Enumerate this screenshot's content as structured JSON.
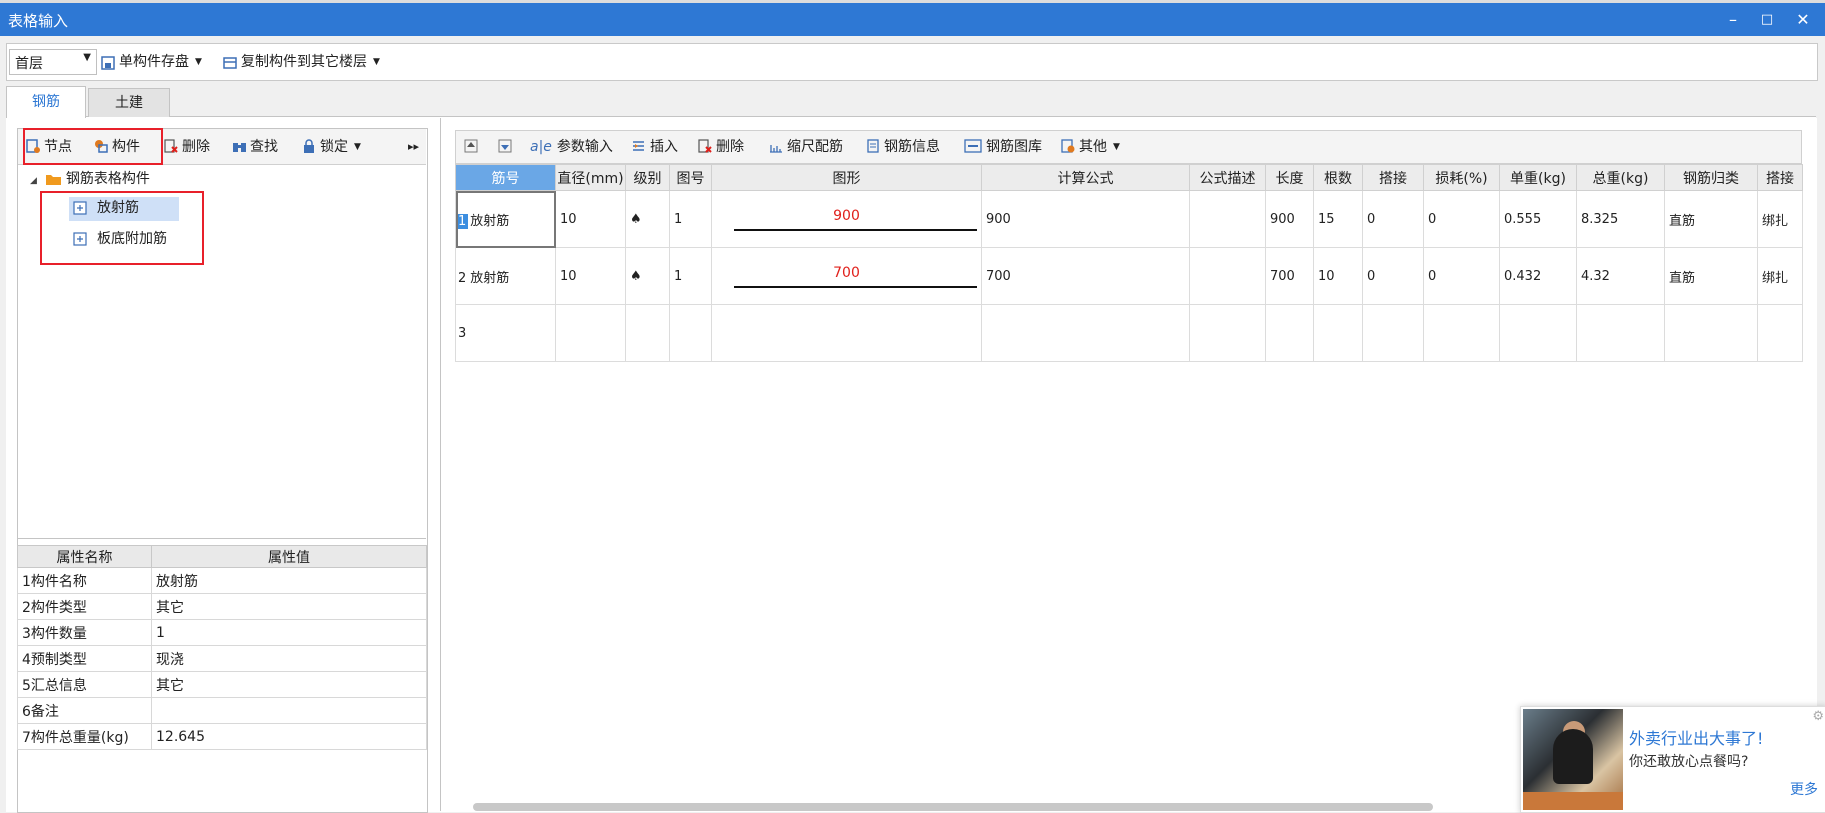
{
  "window": {
    "title": "表格输入",
    "minimize": "–",
    "maximize": "□",
    "close": "✕"
  },
  "toolbar": {
    "floor_value": "首层",
    "save_label": "单构件存盘",
    "copy_label": "复制构件到其它楼层"
  },
  "tabs": [
    "钢筋",
    "土建"
  ],
  "left_toolbar": {
    "node": "节点",
    "component": "构件",
    "delete": "删除",
    "find": "查找",
    "lock": "锁定",
    "more": "▸▸"
  },
  "tree": {
    "root": "钢筋表格构件",
    "items": [
      "放射筋",
      "板底附加筋"
    ]
  },
  "properties": {
    "headers": [
      "属性名称",
      "属性值"
    ],
    "rows": [
      {
        "n": "1",
        "name": "构件名称",
        "value": "放射筋"
      },
      {
        "n": "2",
        "name": "构件类型",
        "value": "其它"
      },
      {
        "n": "3",
        "name": "构件数量",
        "value": "1"
      },
      {
        "n": "4",
        "name": "预制类型",
        "value": "现浇"
      },
      {
        "n": "5",
        "name": "汇总信息",
        "value": "其它"
      },
      {
        "n": "6",
        "name": "备注",
        "value": ""
      },
      {
        "n": "7",
        "name": "构件总重量(kg)",
        "value": "12.645"
      }
    ]
  },
  "right_toolbar": {
    "param_input": "参数输入",
    "insert": "插入",
    "delete": "删除",
    "scale": "缩尺配筋",
    "rebar_info": "钢筋信息",
    "rebar_lib": "钢筋图库",
    "other": "其他"
  },
  "grid": {
    "headers": [
      "筋号",
      "直径(mm)",
      "级别",
      "图号",
      "图形",
      "计算公式",
      "公式描述",
      "长度",
      "根数",
      "搭接",
      "损耗(%)",
      "单重(kg)",
      "总重(kg)",
      "钢筋归类",
      "搭接"
    ],
    "rows": [
      {
        "n": "1",
        "name": "放射筋",
        "dia": "10",
        "grade": "♠",
        "fig": "1",
        "shape": "900",
        "formula": "900",
        "desc": "",
        "len": "900",
        "count": "15",
        "lap": "0",
        "loss": "0",
        "unit_w": "0.555",
        "total_w": "8.325",
        "cat": "直筋",
        "lap2": "绑扎"
      },
      {
        "n": "2",
        "name": "放射筋",
        "dia": "10",
        "grade": "♠",
        "fig": "1",
        "shape": "700",
        "formula": "700",
        "desc": "",
        "len": "700",
        "count": "10",
        "lap": "0",
        "loss": "0",
        "unit_w": "0.432",
        "total_w": "4.32",
        "cat": "直筋",
        "lap2": "绑扎"
      },
      {
        "n": "3",
        "name": "",
        "dia": "",
        "grade": "",
        "fig": "",
        "shape": "",
        "formula": "",
        "desc": "",
        "len": "",
        "count": "",
        "lap": "",
        "loss": "",
        "unit_w": "",
        "total_w": "",
        "cat": "",
        "lap2": ""
      }
    ]
  },
  "popup": {
    "title": "外卖行业出大事了!",
    "subtitle": "你还敢放心点餐吗?",
    "more": "更多"
  }
}
